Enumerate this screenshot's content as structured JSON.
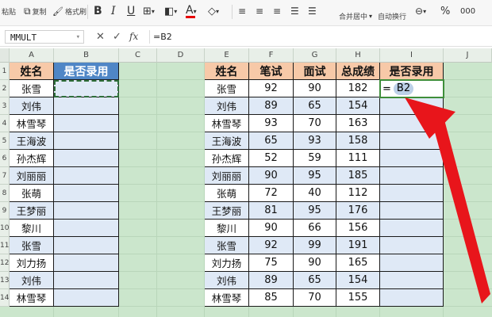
{
  "ribbon": {
    "paste_label": "粘贴",
    "copy_label": "复制",
    "format_painter_label": "格式刷",
    "bold": "B",
    "italic": "I",
    "underline": "U",
    "font_color": "A",
    "merge_label": "合并居中",
    "wrap_label": "自动换行",
    "percent": "%",
    "thousands": "000"
  },
  "formula_bar": {
    "name_box": "MMULT",
    "cancel": "✕",
    "confirm": "✓",
    "fx": "fx",
    "content": "=B2"
  },
  "columns": [
    "A",
    "B",
    "C",
    "D",
    "E",
    "F",
    "G",
    "H",
    "I",
    "J"
  ],
  "rows": [
    "1",
    "2",
    "3",
    "4",
    "5",
    "6",
    "7",
    "8",
    "9",
    "10",
    "11",
    "12",
    "13",
    "14"
  ],
  "left_table": {
    "headers": [
      "姓名",
      "是否录用"
    ],
    "names": [
      "张雪",
      "刘伟",
      "林雪琴",
      "王海波",
      "孙杰辉",
      "刘丽丽",
      "张萌",
      "王梦丽",
      "黎川",
      "张雪",
      "刘力扬",
      "刘伟",
      "林雪琴"
    ]
  },
  "right_table": {
    "headers": [
      "姓名",
      "笔试",
      "面试",
      "总成绩",
      "是否录用"
    ],
    "rows": [
      [
        "张雪",
        "92",
        "90",
        "182"
      ],
      [
        "刘伟",
        "89",
        "65",
        "154"
      ],
      [
        "林雪琴",
        "93",
        "70",
        "163"
      ],
      [
        "王海波",
        "65",
        "93",
        "158"
      ],
      [
        "孙杰辉",
        "52",
        "59",
        "111"
      ],
      [
        "刘丽丽",
        "90",
        "95",
        "185"
      ],
      [
        "张萌",
        "72",
        "40",
        "112"
      ],
      [
        "王梦丽",
        "81",
        "95",
        "176"
      ],
      [
        "黎川",
        "90",
        "66",
        "156"
      ],
      [
        "张雪",
        "92",
        "99",
        "191"
      ],
      [
        "刘力扬",
        "75",
        "90",
        "165"
      ],
      [
        "刘伟",
        "89",
        "65",
        "154"
      ],
      [
        "林雪琴",
        "85",
        "70",
        "155"
      ]
    ]
  },
  "active_cell": {
    "address": "I2",
    "equals": "=",
    "reference": "B2"
  },
  "colors": {
    "header_orange": "#f7c9a8",
    "header_blue": "#4f86c6",
    "row_blue": "#dfe9f6",
    "sheet_green": "#cbe6cc",
    "arrow_red": "#e8151b"
  }
}
